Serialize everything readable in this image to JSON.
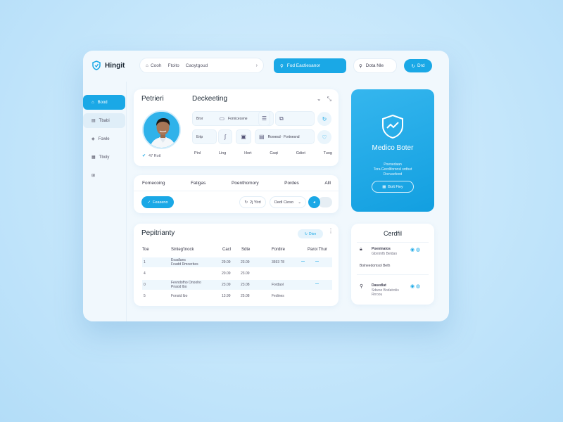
{
  "app": {
    "name": "Hingit"
  },
  "header": {
    "crumbs": [
      "Cooh",
      "Ftoito",
      "Caoytgoud"
    ],
    "search_button": "Fod Eactiesanor",
    "search2": "Dota Nle",
    "pill_button": "Drd"
  },
  "sidebar": {
    "items": [
      {
        "label": "Bood",
        "icon": "home-icon"
      },
      {
        "label": "Tbabi",
        "icon": "file-icon"
      },
      {
        "label": "Fowle",
        "icon": "shield-icon"
      },
      {
        "label": "Tboly",
        "icon": "calendar-icon"
      },
      {
        "label": "",
        "icon": "grid-icon"
      }
    ]
  },
  "patient": {
    "title": "Petrieri",
    "header": "Deckeeting",
    "id_text": "47 Rotl",
    "grid": [
      {
        "label": "Bror",
        "icon": ""
      },
      {
        "label": "Fornicecene",
        "icon": "chat-icon"
      },
      {
        "label": "",
        "icon": "note-icon"
      },
      {
        "label": "",
        "icon": "pill-icon"
      },
      {
        "label": "Ertp",
        "icon": ""
      },
      {
        "label": "",
        "icon": "pulse-icon"
      },
      {
        "label": "",
        "icon": "doc-icon"
      },
      {
        "label": "Rowesd · Fortnesnd",
        "icon": "folder-icon"
      }
    ],
    "labels": [
      "Pinl",
      "Ling",
      "Hert",
      "Caqt",
      "Gdiet",
      "Tuog"
    ]
  },
  "promo": {
    "title": "Medico Boter",
    "sub_line1": "Poenedaan",
    "sub_line2": "Tora Gocdiforonsl srdbut",
    "sub_line3": "Docvaofeod",
    "button": "Bolt Finy"
  },
  "filters": {
    "tabs": [
      "Fornecoing",
      "Fatigas",
      "Poenthomory",
      "Pordes",
      "Alll"
    ],
    "chip": "Feaseno",
    "date": "2j Ylrd",
    "dropdown": "Dedl Cioso"
  },
  "table": {
    "title": "Pepitrianty",
    "action_button": "Dion",
    "headers": [
      "Toe",
      "Sinteg'tnock",
      "Cacl",
      "Sdte",
      "Fordire",
      "Paroi Thur"
    ],
    "rows": [
      {
        "id": "1",
        "name": "Eoadlans",
        "name2": "Foadd Rmoerbes",
        "cacl": "29.09",
        "sdte": "23.09",
        "fordire": "3693 78",
        "striped": true
      },
      {
        "id": "4",
        "name": "",
        "name2": "",
        "cacl": "20.09",
        "sdte": "23.09",
        "fordire": "",
        "striped": false
      },
      {
        "id": "0",
        "name": "Fevndofho Onooho",
        "name2": "Pnaod lbo",
        "cacl": "23.09",
        "sdte": "23.08",
        "fordire": "Fordaol",
        "striped": true
      },
      {
        "id": "5",
        "name": "Fonstd lbo",
        "name2": "",
        "cacl": "13.99",
        "sdte": "25.08",
        "fordire": "Fedines",
        "striped": false
      }
    ]
  },
  "side_card": {
    "title": "Cerdfil",
    "items": [
      {
        "name": "Poeninatos",
        "sub": "Gbntmfb Beldan",
        "note": "Bolneedomsol Beth"
      },
      {
        "name": "Dasedlat",
        "sub": "Sdwoo Bodatrolis",
        "note": "Rrroou"
      }
    ]
  },
  "colors": {
    "accent": "#1aa8e6",
    "panel": "#f1f8fd"
  }
}
